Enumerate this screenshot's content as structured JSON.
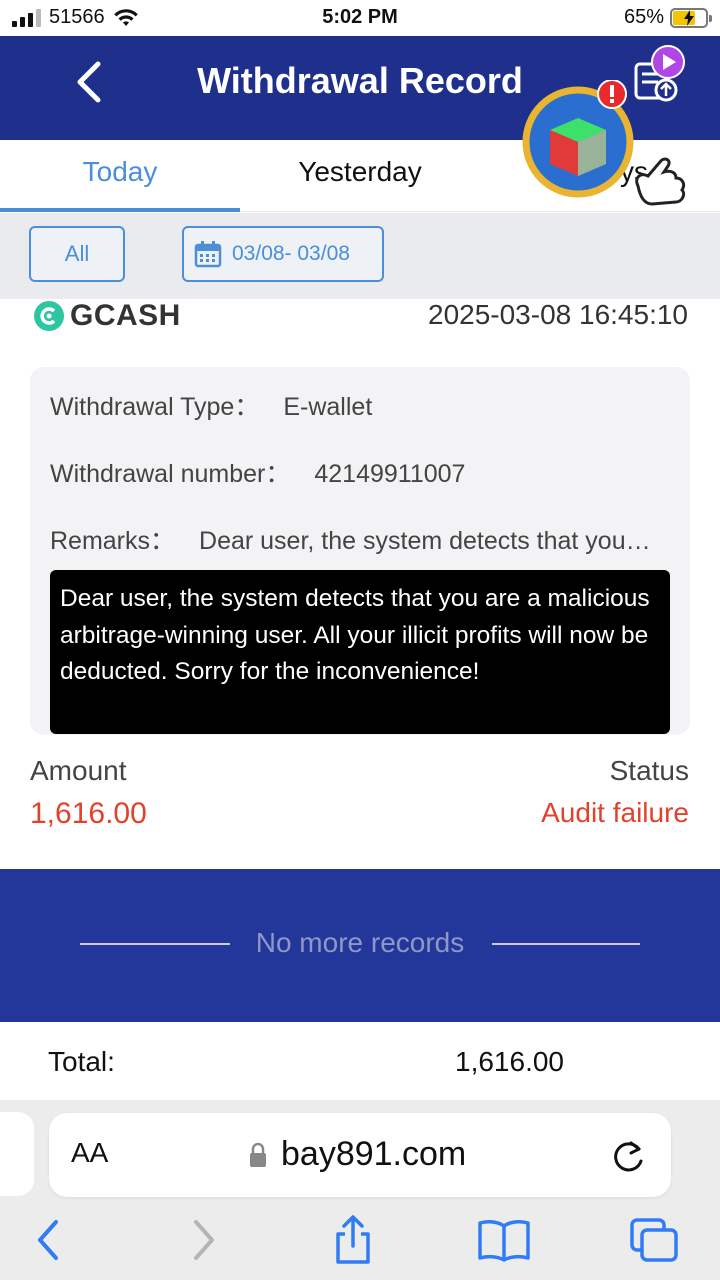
{
  "status_bar": {
    "carrier": "51566",
    "time": "5:02 PM",
    "battery": "65%"
  },
  "header": {
    "title": "Withdrawal Record"
  },
  "tabs": [
    {
      "label": "Today",
      "active": true
    },
    {
      "label": "Yesterday",
      "active": false
    },
    {
      "label": "ys",
      "active": false
    }
  ],
  "filter": {
    "all_label": "All",
    "date_range": "03/08- 03/08"
  },
  "record": {
    "provider": "GCASH",
    "datetime": "2025-03-08 16:45:10",
    "type_label": "Withdrawal Type：",
    "type_value": "E-wallet",
    "number_label": "Withdrawal number：",
    "number_value": "42149911007",
    "remarks_label": "Remarks：",
    "remarks_value": "Dear user, the system detects that you…",
    "remarks_full": "Dear user, the system detects that you are a malicious arbitrage-winning user. All your illicit profits will now be deducted. Sorry for the inconvenience!",
    "amount_label": "Amount",
    "amount_value": "1,616.00",
    "status_label": "Status",
    "status_value": "Audit failure"
  },
  "no_more": "No more records",
  "total": {
    "label": "Total:",
    "value": "1,616.00"
  },
  "browser": {
    "aa_label": "AA",
    "url": "bay891.com"
  },
  "colors": {
    "header_bg": "#1f2f8c",
    "accent": "#4a8fd8",
    "error": "#e0422b",
    "no_more_bg": "#23379a"
  }
}
